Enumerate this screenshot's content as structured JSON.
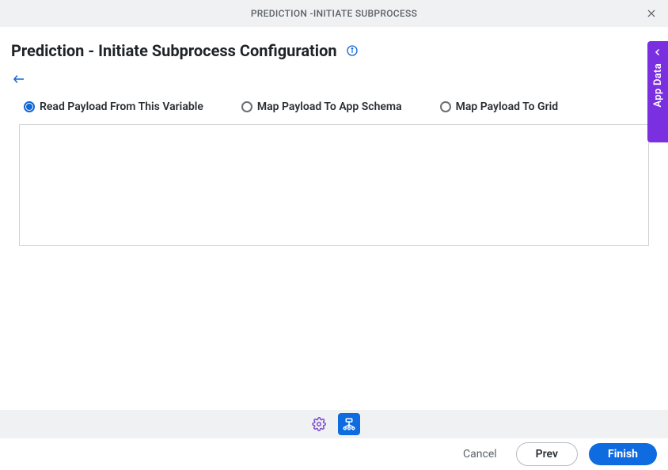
{
  "titlebar": "PREDICTION -INITIATE SUBPROCESS",
  "page_title": "Prediction - Initiate Subprocess Configuration",
  "radios": {
    "read_variable": "Read Payload From This Variable",
    "map_schema": "Map Payload To App Schema",
    "map_grid": "Map Payload To Grid"
  },
  "side_tab": "App Data",
  "footer": {
    "cancel": "Cancel",
    "prev": "Prev",
    "finish": "Finish"
  }
}
